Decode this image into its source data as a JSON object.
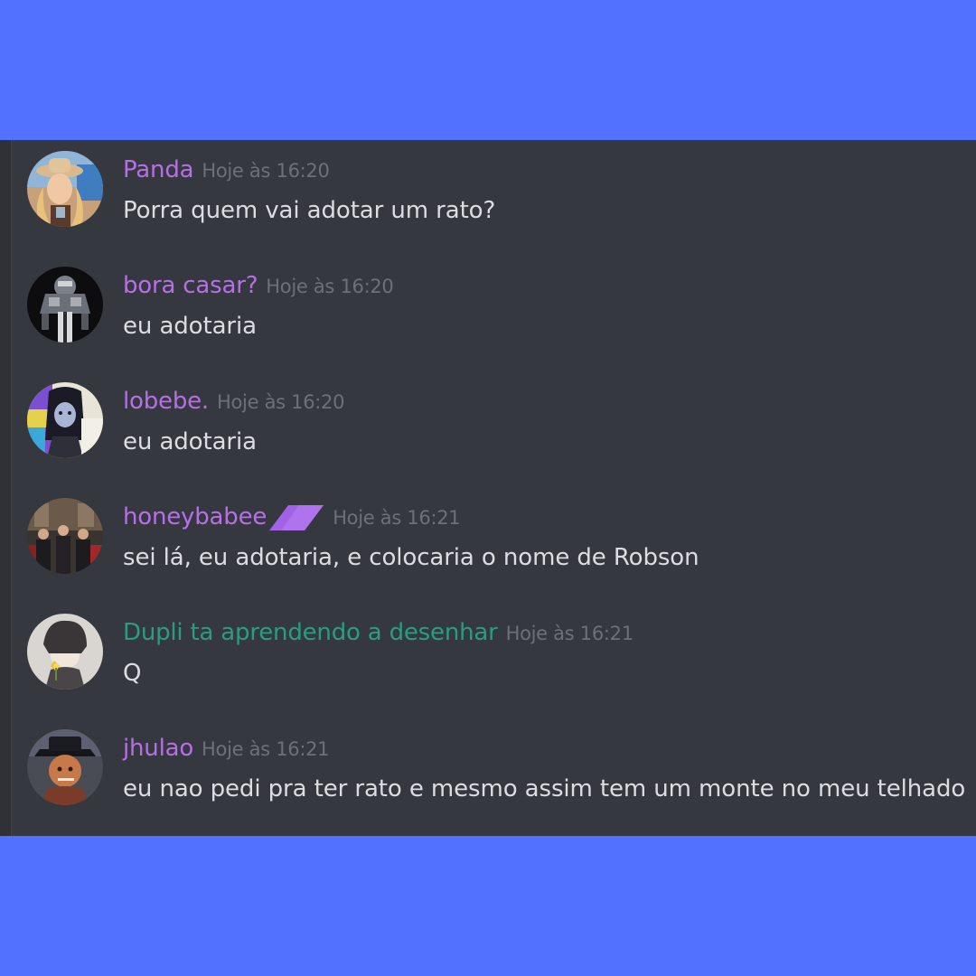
{
  "colors": {
    "outer_background": "#5271ff",
    "chat_background": "#36383f",
    "username_purple": "#b76fe6",
    "username_teal": "#2c9c80",
    "timestamp": "#6d7078",
    "message_text": "#dcdde0"
  },
  "messages": [
    {
      "username": "Panda",
      "timestamp": "Hoje às 16:20",
      "text": "Porra quem vai adotar um rato?",
      "avatar": "cowgirl-avatar"
    },
    {
      "username": "bora casar?",
      "timestamp": "Hoje às 16:20",
      "text": "eu adotaria",
      "avatar": "armored-figure-avatar"
    },
    {
      "username": "lobebe.",
      "timestamp": "Hoje às 16:20",
      "text": "eu adotaria",
      "avatar": "cartoon-vampire-avatar"
    },
    {
      "username": "honeybabee",
      "timestamp": "Hoje às 16:21",
      "text": "sei lá, eu adotaria, e colocaria o nome de Robson",
      "avatar": "group-photo-avatar",
      "badge": "purple-parallelogram-badge"
    },
    {
      "username": "Dupli ta aprendendo a desenhar",
      "timestamp": "Hoje às 16:21",
      "text": "Q",
      "avatar": "anime-boy-avatar"
    },
    {
      "username": "jhulao",
      "timestamp": "Hoje às 16:21",
      "text": "eu nao pedi pra ter rato e mesmo assim tem um monte no meu telhado",
      "avatar": "hat-character-avatar"
    }
  ]
}
